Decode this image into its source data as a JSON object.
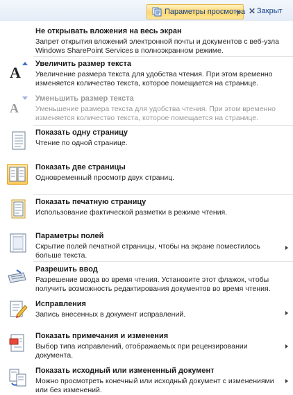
{
  "toolbar": {
    "view_options_label": "Параметры просмотра",
    "close_label": "Закрыт"
  },
  "menu": {
    "items": [
      {
        "title": "Не открывать вложения на весь экран",
        "description": "Запрет открытия вложений электронной почты и документов с веб-узла Windows SharePoint Services в полноэкранном режиме.",
        "icon": "none"
      },
      {
        "title": "Увеличить размер текста",
        "description": "Увеличение размера текста для удобства чтения. При этом временно изменяется количество текста, которое помещается на странице.",
        "icon": "increase-font-icon"
      },
      {
        "title": "Уменьшить размер текста",
        "description": "Уменьшение размера текста для удобства чтения. При этом временно изменяется количество текста, которое помещается на странице.",
        "icon": "decrease-font-icon",
        "disabled": true
      },
      {
        "title": "Показать одну страницу",
        "description": "Чтение по одной странице.",
        "icon": "one-page-icon"
      },
      {
        "title": "Показать две страницы",
        "description": "Одновременный просмотр двух страниц.",
        "icon": "two-pages-icon",
        "selected": true
      },
      {
        "title": "Показать печатную страницу",
        "description": "Использование фактической разметки в режиме чтения.",
        "icon": "print-page-icon"
      },
      {
        "title": "Параметры полей",
        "description": "Скрытие полей печатной страницы, чтобы на экране поместилось больше текста.",
        "icon": "margins-icon",
        "submenu": true
      },
      {
        "title": "Разрешить ввод",
        "description": "Разрешение ввода во время чтения. Установите этот флажок, чтобы получить возможность редактирования документов во время чтения.",
        "icon": "keyboard-icon"
      },
      {
        "title": "Исправления",
        "description": "Запись внесенных в документ исправлений.",
        "icon": "track-changes-icon",
        "submenu": true
      },
      {
        "title": "Показать примечания и изменения",
        "description": "Выбор типа исправлений, отображаемых при рецензировании документа.",
        "icon": "show-markup-icon",
        "submenu": true
      },
      {
        "title": "Показать исходный или измененный документ",
        "description": "Можно просмотреть конечный или исходный документ с изменениями или без изменений.",
        "icon": "compare-documents-icon",
        "submenu": true
      }
    ]
  }
}
